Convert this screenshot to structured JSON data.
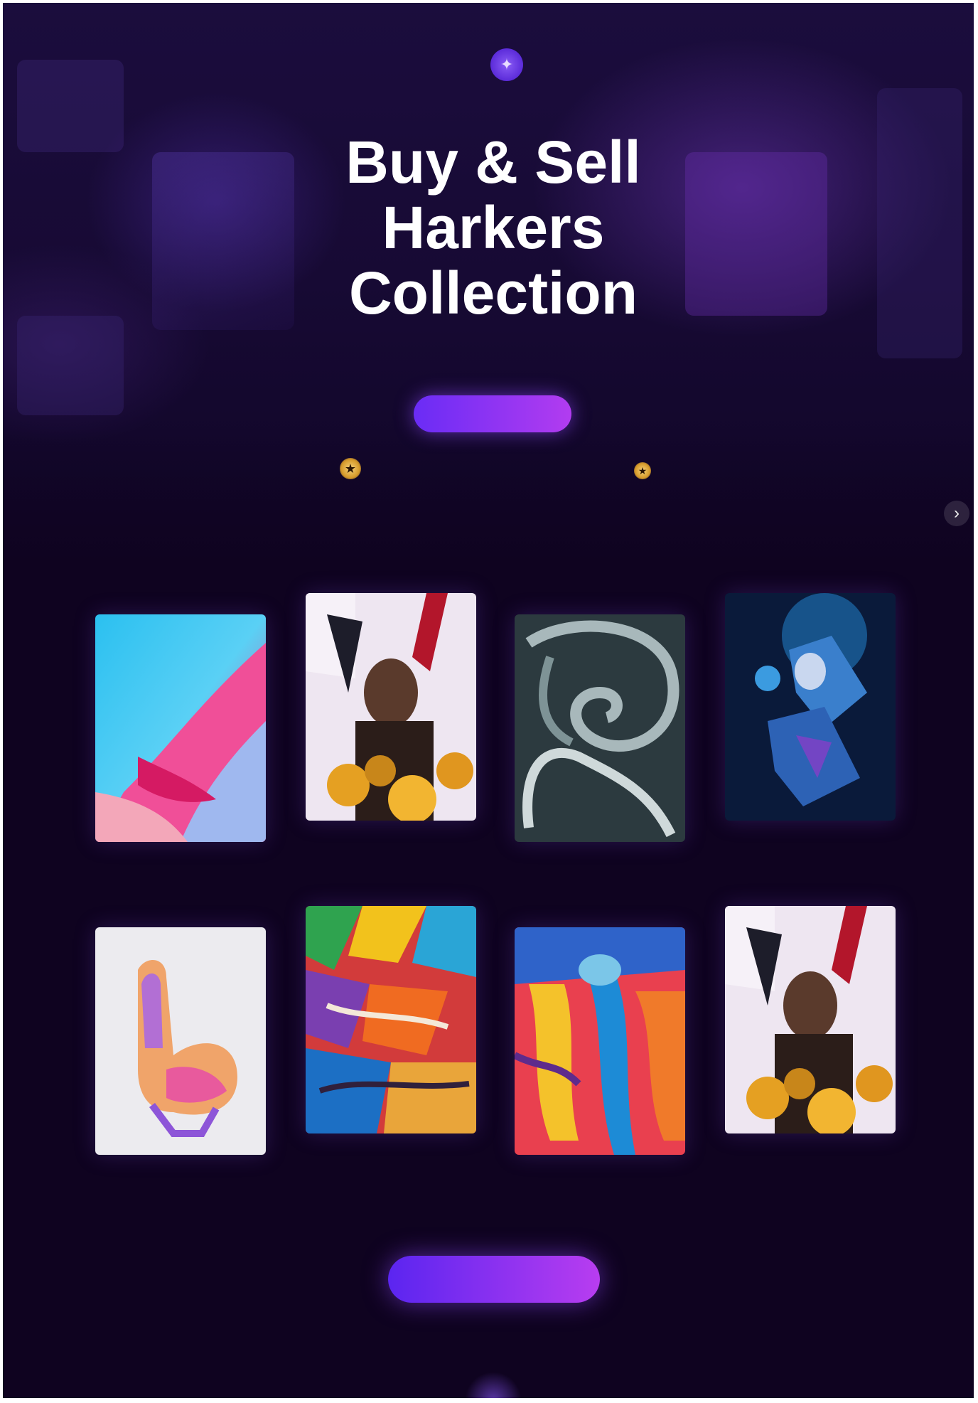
{
  "brand": {
    "logo_text": ""
  },
  "nav": {
    "items": [
      {
        "label": ""
      },
      {
        "label": ""
      },
      {
        "label": ""
      },
      {
        "label": ""
      }
    ]
  },
  "hero": {
    "title_lines": [
      "Buy & Sell",
      "Harkers",
      "Collection"
    ],
    "subtitle": "",
    "cta_label": ""
  },
  "gallery": {
    "cards": [
      {
        "caption": "",
        "art": "pink-cyan-abstract"
      },
      {
        "caption": "",
        "art": "figure-sunflowers"
      },
      {
        "caption": "",
        "art": "grey-swirl"
      },
      {
        "caption": "",
        "art": "blue-figure"
      },
      {
        "caption": "",
        "art": "pink-bird"
      },
      {
        "caption": "",
        "art": "rainbow-mosaic"
      },
      {
        "caption": "",
        "art": "colorful-figures"
      },
      {
        "caption": "",
        "art": "figure-sunflowers"
      }
    ]
  },
  "footer": {
    "cta_label": ""
  },
  "colors": {
    "accent": "#7b33f2",
    "accent_end": "#b83df0",
    "background": "#0f0320",
    "star": "#f2c260"
  },
  "icons": {
    "emblem": "sparkle-icon",
    "next": "chevron-right-icon",
    "star": "star-icon"
  }
}
